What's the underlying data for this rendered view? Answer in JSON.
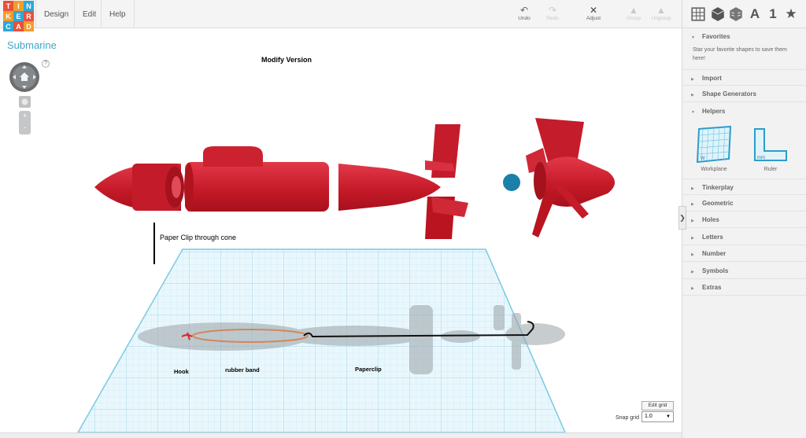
{
  "logo": {
    "letters": [
      "T",
      "I",
      "N",
      "K",
      "E",
      "R",
      "C",
      "A",
      "D"
    ],
    "colors": [
      "#e8503a",
      "#f39c2b",
      "#2ca8d8",
      "#f39c2b",
      "#2ca8d8",
      "#e8503a",
      "#2ca8d8",
      "#e8503a",
      "#f39c2b"
    ]
  },
  "menu": {
    "design": "Design",
    "edit": "Edit",
    "help": "Help"
  },
  "toolbar": {
    "undo": "Undo",
    "redo": "Redo",
    "adjust": "Adjust",
    "group": "Group",
    "ungroup": "Ungroup"
  },
  "panel_tabs": {
    "letters_tab": "A",
    "number_tab": "1",
    "star_tab": "★"
  },
  "panel": {
    "favorites": "Favorites",
    "favorites_hint": "Star your favorite shapes to save them here!",
    "import": "Import",
    "shape_generators": "Shape Generators",
    "helpers": "Helpers",
    "workplane": "Workplane",
    "ruler": "Ruler",
    "tinkerplay": "Tinkerplay",
    "geometric": "Geometric",
    "holes": "Holes",
    "letters": "Letters",
    "number": "Number",
    "symbols": "Symbols",
    "extras": "Extras"
  },
  "workspace": {
    "project_title": "Submarine",
    "view_title": "Modify Version",
    "help_mark": "?",
    "zoom_in": "+",
    "zoom_out": "-",
    "annotation_clip": "Paper Clip through cone",
    "label_hook": "Hook",
    "label_band": "rubber band",
    "label_paperclip": "Paperclip",
    "edit_grid": "Edit grid",
    "snap_label": "Snap grid",
    "snap_value": "1.0"
  },
  "colors": {
    "accent": "#3fa7c6",
    "model_red": "#c8202c",
    "grid": "#a9dff0"
  }
}
